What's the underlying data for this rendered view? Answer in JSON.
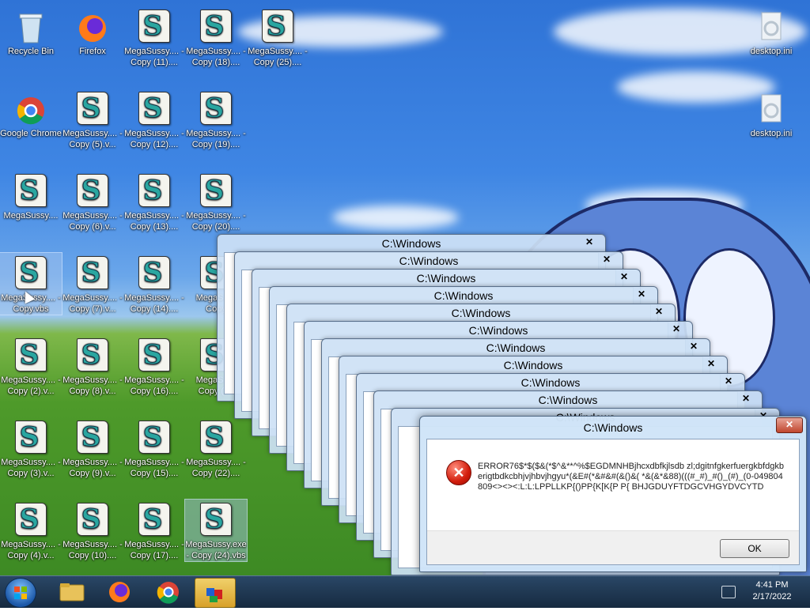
{
  "desktop": {
    "icons": [
      {
        "label": "Recycle Bin",
        "kind": "recycle-bin"
      },
      {
        "label": "Firefox",
        "kind": "firefox"
      },
      {
        "label": "MegaSussy.... - Copy (11)....",
        "kind": "vbs"
      },
      {
        "label": "MegaSussy.... - Copy (18)....",
        "kind": "vbs"
      },
      {
        "label": "MegaSussy.... - Copy (25)....",
        "kind": "vbs"
      },
      {
        "label": "Google Chrome",
        "kind": "chrome"
      },
      {
        "label": "MegaSussy.... - Copy (5).v...",
        "kind": "vbs"
      },
      {
        "label": "MegaSussy.... - Copy (12)....",
        "kind": "vbs"
      },
      {
        "label": "MegaSussy.... - Copy (19)....",
        "kind": "vbs"
      },
      {
        "label": "MegaSussy....",
        "kind": "vbs"
      },
      {
        "label": "MegaSussy.... - Copy (6).v...",
        "kind": "vbs"
      },
      {
        "label": "MegaSussy.... - Copy (13)....",
        "kind": "vbs"
      },
      {
        "label": "MegaSussy.... - Copy (20)....",
        "kind": "vbs"
      },
      {
        "label": "MegaSussy.... - Copy.vbs",
        "kind": "vbs"
      },
      {
        "label": "MegaSussy.... - Copy (7).v...",
        "kind": "vbs"
      },
      {
        "label": "MegaSussy.... - Copy (14)....",
        "kind": "vbs"
      },
      {
        "label": "MegaS... - Copy",
        "kind": "vbs"
      },
      {
        "label": "MegaSussy.... - Copy (2).v...",
        "kind": "vbs"
      },
      {
        "label": "MegaSussy.... - Copy (8).v...",
        "kind": "vbs"
      },
      {
        "label": "MegaSussy.... - Copy (16)....",
        "kind": "vbs"
      },
      {
        "label": "MegaS... - Copy (23",
        "kind": "vbs"
      },
      {
        "label": "MegaSussy.... - Copy (3).v...",
        "kind": "vbs"
      },
      {
        "label": "MegaSussy.... - Copy (9).v...",
        "kind": "vbs"
      },
      {
        "label": "MegaSussy.... - Copy (15)....",
        "kind": "vbs"
      },
      {
        "label": "MegaSussy.... - Copy (22)....",
        "kind": "vbs"
      },
      {
        "label": "MegaSussy.... - Copy (4).v...",
        "kind": "vbs"
      },
      {
        "label": "MegaSussy.... - Copy (10)....",
        "kind": "vbs"
      },
      {
        "label": "MegaSussy.... - Copy (17)....",
        "kind": "vbs"
      },
      {
        "label": "MegaSussy.exe - Copy (24).vbs",
        "kind": "vbs"
      },
      {
        "label": "desktop.ini",
        "kind": "ini"
      },
      {
        "label": "desktop.ini",
        "kind": "ini"
      }
    ]
  },
  "stacked_windows": {
    "title": "C:\\Windows",
    "close_glyph": "✕",
    "count": 11
  },
  "dialog": {
    "title": "C:\\Windows",
    "close_glyph": "✕",
    "error_glyph": "✕",
    "message": "ERROR76$*$($&(*$^&**^%$EGDMNHBjhcxdbfkjlsdb zl;dgitnfgkerfuergkbfdgkberigtbdkcbhjvjhbvjhgyu*(&E#(*&#&#(&()&( *&(&*&88)(((#_#)_#()_(#)_(0-049804809<><><:L:L:LPPLLKP{()PP{K[K{P P{ BHJGDUYFTDGCVHGYDVCYTD",
    "ok_label": "OK"
  },
  "taskbar": {
    "clock_time": "4:41 PM",
    "clock_date": "2/17/2022",
    "items": [
      "file-explorer",
      "firefox",
      "chrome",
      "vbs-script-host"
    ]
  }
}
